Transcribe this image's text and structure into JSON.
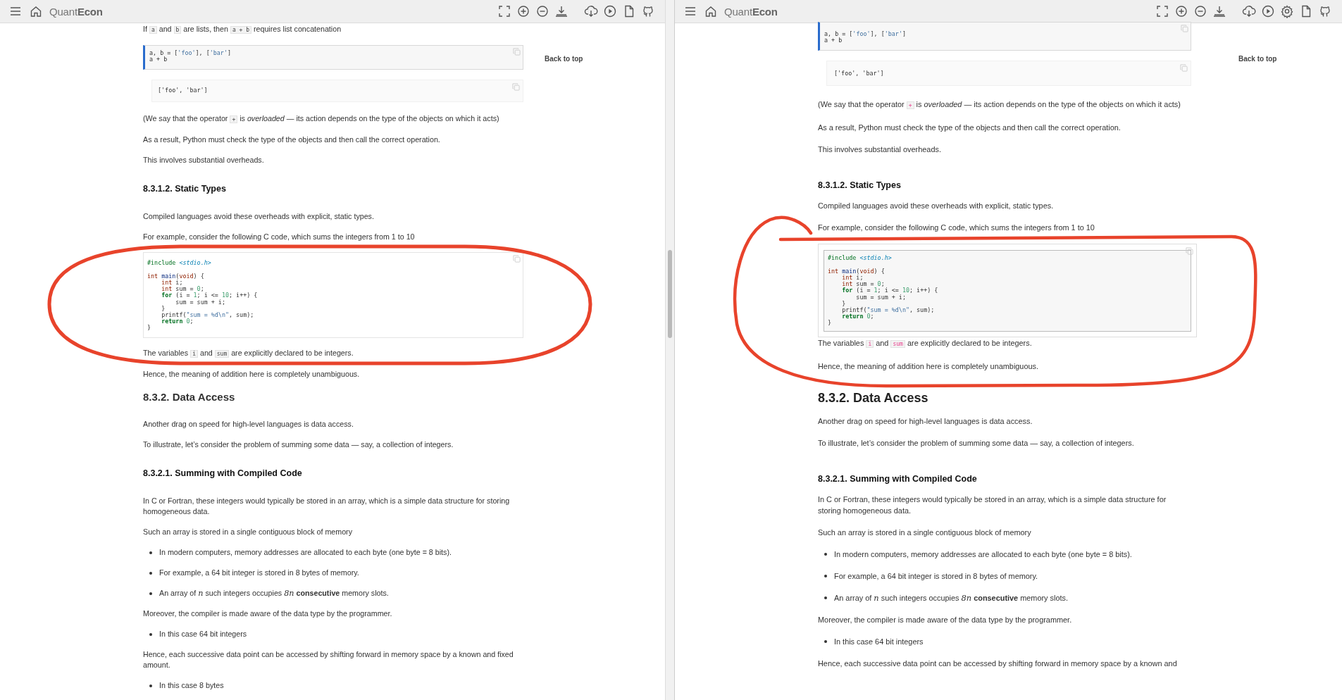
{
  "panes": [
    {
      "kind": "plain",
      "toolbar": {
        "logo": "Quant**Econ**",
        "view_icons": [
          {
            "kind": "fullscreen"
          },
          {
            "kind": "zoom-in"
          },
          {
            "kind": "zoom-out"
          },
          {
            "kind": "download"
          }
        ],
        "action_icons": [
          {
            "kind": "cloud-download"
          },
          {
            "kind": "play"
          },
          {
            "kind": "file"
          },
          {
            "kind": "github"
          }
        ]
      },
      "back_to_top": "Back to top",
      "blocks": [
        {
          "kind": "p",
          "parts": [
            {
              "text": "If "
            },
            {
              "code": "a"
            },
            {
              "text": " and "
            },
            {
              "code": "b"
            },
            {
              "text": " are lists, then "
            },
            {
              "code": "a + b"
            },
            {
              "text": " requires list concatenation"
            }
          ]
        },
        {
          "kind": "input",
          "lines": [
            [
              {
                "kind": "plain",
                "text": "a, b = ["
              },
              {
                "kind": "string",
                "text": "'foo'"
              },
              {
                "kind": "plain",
                "text": "], ["
              },
              {
                "kind": "string",
                "text": "'bar'"
              },
              {
                "kind": "plain",
                "text": "]"
              }
            ],
            [
              {
                "kind": "plain",
                "text": "a + b"
              }
            ]
          ]
        },
        {
          "kind": "output",
          "lines": [
            "['foo', 'bar']"
          ]
        },
        {
          "kind": "p",
          "parts": [
            {
              "text": "(We say that the operator "
            },
            {
              "code": "+"
            },
            {
              "text": " is *overloaded* — its action depends on the type of the objects on which it acts)"
            }
          ]
        },
        {
          "kind": "p",
          "parts": [
            {
              "text": "As a result, Python must check the type of the objects and then call the correct operation."
            }
          ]
        },
        {
          "kind": "p",
          "parts": [
            {
              "text": "This involves substantial overheads."
            }
          ]
        },
        {
          "kind": "h3",
          "text": "8.3.1.2. Static Types"
        },
        {
          "kind": "p",
          "parts": [
            {
              "text": "Compiled languages avoid these overheads with explicit, static types."
            }
          ]
        },
        {
          "kind": "p",
          "parts": [
            {
              "text": "For example, consider the following C code, which sums the integers from 1 to 10"
            }
          ]
        },
        {
          "kind": "code",
          "header": [
            {
              "kind": "preproc",
              "text": "#include "
            },
            {
              "kind": "include",
              "text": "<stdio.h>"
            }
          ],
          "lines": [
            [
              {
                "kind": "type",
                "text": "int"
              },
              {
                "kind": "func",
                "text": " main"
              },
              {
                "kind": "plain",
                "text": "("
              },
              {
                "kind": "type",
                "text": "void"
              },
              {
                "kind": "plain",
                "text": ") {"
              }
            ],
            [
              {
                "kind": "type",
                "text": "    int"
              },
              {
                "kind": "plain",
                "text": " i;"
              }
            ],
            [
              {
                "kind": "type",
                "text": "    int"
              },
              {
                "kind": "plain",
                "text": " sum = "
              },
              {
                "kind": "number",
                "text": "0"
              },
              {
                "kind": "plain",
                "text": ";"
              }
            ],
            [
              {
                "kind": "keyword",
                "text": "    for"
              },
              {
                "kind": "plain",
                "text": " (i = "
              },
              {
                "kind": "number",
                "text": "1"
              },
              {
                "kind": "plain",
                "text": "; i <= "
              },
              {
                "kind": "number",
                "text": "10"
              },
              {
                "kind": "plain",
                "text": "; i++) {"
              }
            ],
            [
              {
                "kind": "plain",
                "text": "        sum = sum + i;"
              }
            ],
            [
              {
                "kind": "plain",
                "text": "    }"
              }
            ],
            [
              {
                "kind": "plain",
                "text": "    printf("
              },
              {
                "kind": "string",
                "text": "\"sum = %d\\n\""
              },
              {
                "kind": "plain",
                "text": ", sum);"
              }
            ],
            [
              {
                "kind": "keyword",
                "text": "    return"
              },
              {
                "kind": "number",
                "text": " 0"
              },
              {
                "kind": "plain",
                "text": ";"
              }
            ],
            [
              {
                "kind": "plain",
                "text": "}"
              }
            ]
          ]
        },
        {
          "kind": "p",
          "parts": [
            {
              "text": "The variables "
            },
            {
              "code": "i"
            },
            {
              "text": " and "
            },
            {
              "code": "sum"
            },
            {
              "text": " are explicitly declared to be integers."
            }
          ]
        },
        {
          "kind": "p",
          "parts": [
            {
              "text": "Hence, the meaning of addition here is completely unambiguous."
            }
          ]
        },
        {
          "kind": "h2",
          "text": "8.3.2. Data Access"
        },
        {
          "kind": "p",
          "parts": [
            {
              "text": "Another drag on speed for high-level languages is data access."
            }
          ]
        },
        {
          "kind": "p",
          "parts": [
            {
              "text": "To illustrate, let’s consider the problem of summing some data — say, a collection of integers."
            }
          ]
        },
        {
          "kind": "h3",
          "text": "8.3.2.1. Summing with Compiled Code"
        },
        {
          "kind": "p",
          "parts": [
            {
              "text": "In C or Fortran, these integers would typically be stored in an array, which is a simple data structure for storing homogeneous data."
            }
          ]
        },
        {
          "kind": "p",
          "parts": [
            {
              "text": "Such an array is stored in a single contiguous block of memory"
            }
          ]
        },
        {
          "kind": "list",
          "items": [
            [
              {
                "text": "In modern computers, memory addresses are allocated to each byte (one byte = 8 bits)."
              }
            ],
            [
              {
                "text": "For example, a 64 bit integer is stored in 8 bytes of memory."
              }
            ],
            [
              {
                "text": "An array of "
              },
              {
                "math": "n"
              },
              {
                "text": " such integers occupies "
              },
              {
                "math": "8n"
              },
              {
                "text": " **consecutive** memory slots."
              }
            ]
          ]
        },
        {
          "kind": "p",
          "parts": [
            {
              "text": "Moreover, the compiler is made aware of the data type by the programmer."
            }
          ]
        },
        {
          "kind": "list",
          "items": [
            [
              {
                "text": "In this case 64 bit integers"
              }
            ]
          ]
        },
        {
          "kind": "p",
          "parts": [
            {
              "text": "Hence, each successive data point can be accessed by shifting forward in memory space by a known and fixed amount."
            }
          ]
        },
        {
          "kind": "list",
          "items": [
            [
              {
                "text": "In this case 8 bytes"
              }
            ]
          ]
        }
      ]
    },
    {
      "kind": "framed",
      "toolbar": {
        "logo": "Quant**Econ**",
        "view_icons": [
          {
            "kind": "fullscreen"
          },
          {
            "kind": "zoom-in"
          },
          {
            "kind": "zoom-out"
          },
          {
            "kind": "download"
          }
        ],
        "action_icons": [
          {
            "kind": "cloud-download"
          },
          {
            "kind": "play"
          },
          {
            "kind": "settings"
          },
          {
            "kind": "file"
          },
          {
            "kind": "github"
          }
        ]
      },
      "back_to_top": "Back to top",
      "blocks": [
        {
          "kind": "input",
          "lines": [
            [
              {
                "kind": "plain",
                "text": "a, b = ["
              },
              {
                "kind": "string",
                "text": "'foo'"
              },
              {
                "kind": "plain",
                "text": "], ["
              },
              {
                "kind": "string",
                "text": "'bar'"
              },
              {
                "kind": "plain",
                "text": "]"
              }
            ],
            [
              {
                "kind": "plain",
                "text": "a + b"
              }
            ]
          ]
        },
        {
          "kind": "output",
          "lines": [
            "['foo', 'bar']"
          ]
        },
        {
          "kind": "p",
          "parts": [
            {
              "text": "(We say that the operator "
            },
            {
              "code": "+"
            },
            {
              "text": " is *overloaded* — its action depends on the type of the objects on which it acts)"
            }
          ]
        },
        {
          "kind": "p",
          "parts": [
            {
              "text": "As a result, Python must check the type of the objects and then call the correct operation."
            }
          ]
        },
        {
          "kind": "p",
          "parts": [
            {
              "text": "This involves substantial overheads."
            }
          ]
        },
        {
          "kind": "h3",
          "text": "8.3.1.2. Static Types"
        },
        {
          "kind": "p",
          "parts": [
            {
              "text": "Compiled languages avoid these overheads with explicit, static types."
            }
          ]
        },
        {
          "kind": "p",
          "parts": [
            {
              "text": "For example, consider the following C code, which sums the integers from 1 to 10"
            }
          ]
        },
        {
          "kind": "code",
          "header": [
            {
              "kind": "preproc",
              "text": "#include "
            },
            {
              "kind": "include",
              "text": "<stdio.h>"
            }
          ],
          "lines": [
            [
              {
                "kind": "type",
                "text": "int"
              },
              {
                "kind": "func",
                "text": " main"
              },
              {
                "kind": "plain",
                "text": "("
              },
              {
                "kind": "type",
                "text": "void"
              },
              {
                "kind": "plain",
                "text": ") {"
              }
            ],
            [
              {
                "kind": "type",
                "text": "    int"
              },
              {
                "kind": "plain",
                "text": " i;"
              }
            ],
            [
              {
                "kind": "type",
                "text": "    int"
              },
              {
                "kind": "plain",
                "text": " sum = "
              },
              {
                "kind": "number",
                "text": "0"
              },
              {
                "kind": "plain",
                "text": ";"
              }
            ],
            [
              {
                "kind": "keyword",
                "text": "    for"
              },
              {
                "kind": "plain",
                "text": " (i = "
              },
              {
                "kind": "number",
                "text": "1"
              },
              {
                "kind": "plain",
                "text": "; i <= "
              },
              {
                "kind": "number",
                "text": "10"
              },
              {
                "kind": "plain",
                "text": "; i++) {"
              }
            ],
            [
              {
                "kind": "plain",
                "text": "        sum = sum + i;"
              }
            ],
            [
              {
                "kind": "plain",
                "text": "    }"
              }
            ],
            [
              {
                "kind": "plain",
                "text": "    printf("
              },
              {
                "kind": "string",
                "text": "\"sum = %d\\n\""
              },
              {
                "kind": "plain",
                "text": ", sum);"
              }
            ],
            [
              {
                "kind": "keyword",
                "text": "    return"
              },
              {
                "kind": "number",
                "text": " 0"
              },
              {
                "kind": "plain",
                "text": ";"
              }
            ],
            [
              {
                "kind": "plain",
                "text": "}"
              }
            ]
          ]
        },
        {
          "kind": "p",
          "parts": [
            {
              "text": "The variables "
            },
            {
              "code": "i"
            },
            {
              "text": " and "
            },
            {
              "code": "sum"
            },
            {
              "text": " are explicitly declared to be integers."
            }
          ]
        },
        {
          "kind": "p",
          "parts": [
            {
              "text": "Hence, the meaning of addition here is completely unambiguous."
            }
          ]
        },
        {
          "kind": "h2",
          "text": "8.3.2. Data Access"
        },
        {
          "kind": "p",
          "parts": [
            {
              "text": "Another drag on speed for high-level languages is data access."
            }
          ]
        },
        {
          "kind": "p",
          "parts": [
            {
              "text": "To illustrate, let’s consider the problem of summing some data — say, a collection of integers."
            }
          ]
        },
        {
          "kind": "h3",
          "text": "8.3.2.1. Summing with Compiled Code"
        },
        {
          "kind": "p",
          "parts": [
            {
              "text": "In C or Fortran, these integers would typically be stored in an array, which is a simple data structure for storing homogeneous data."
            }
          ]
        },
        {
          "kind": "p",
          "parts": [
            {
              "text": "Such an array is stored in a single contiguous block of memory"
            }
          ]
        },
        {
          "kind": "list",
          "items": [
            [
              {
                "text": "In modern computers, memory addresses are allocated to each byte (one byte = 8 bits)."
              }
            ],
            [
              {
                "text": "For example, a 64 bit integer is stored in 8 bytes of memory."
              }
            ],
            [
              {
                "text": "An array of "
              },
              {
                "math": "n"
              },
              {
                "text": " such integers occupies "
              },
              {
                "math": "8n"
              },
              {
                "text": " **consecutive** memory slots."
              }
            ]
          ]
        },
        {
          "kind": "p",
          "parts": [
            {
              "text": "Moreover, the compiler is made aware of the data type by the programmer."
            }
          ]
        },
        {
          "kind": "list",
          "items": [
            [
              {
                "text": "In this case 64 bit integers"
              }
            ]
          ]
        },
        {
          "kind": "p",
          "parts": [
            {
              "text": "Hence, each successive data point can be accessed by shifting forward in memory space by a known and"
            }
          ]
        }
      ]
    }
  ]
}
